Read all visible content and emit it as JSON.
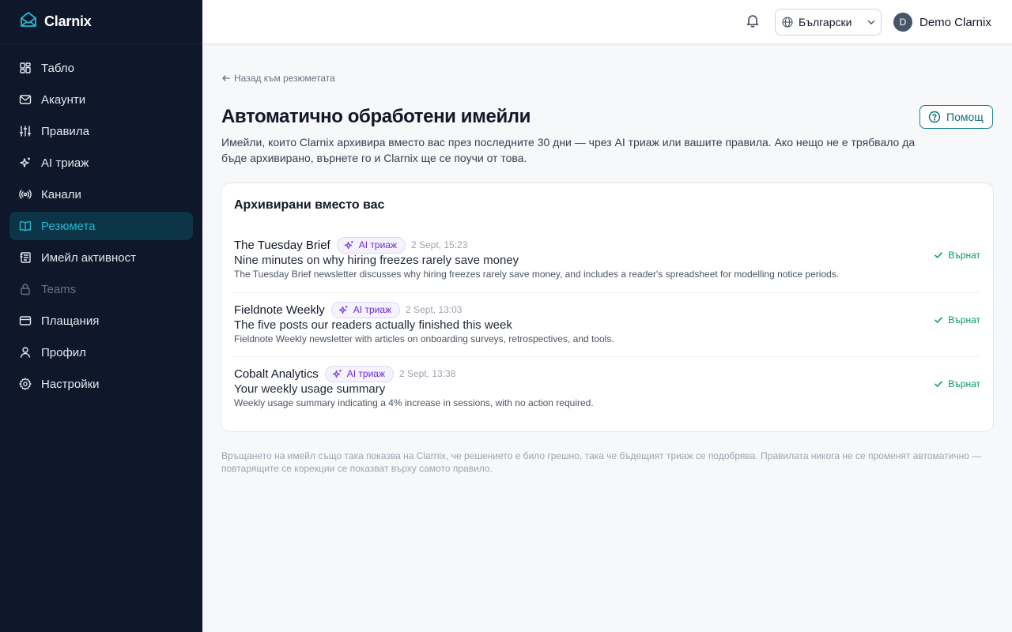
{
  "app": {
    "brand": "Clarnix",
    "accent": "#22b8cf"
  },
  "sidebar": {
    "items": [
      {
        "label": "Табло",
        "icon": "dashboard-icon"
      },
      {
        "label": "Акаунти",
        "icon": "mail-icon"
      },
      {
        "label": "Правила",
        "icon": "sliders-icon"
      },
      {
        "label": "AI триаж",
        "icon": "sparkles-icon"
      },
      {
        "label": "Канали",
        "icon": "radio-icon"
      },
      {
        "label": "Резюмета",
        "icon": "book-open-icon",
        "active": true
      },
      {
        "label": "Имейл активност",
        "icon": "activity-icon"
      },
      {
        "label": "Teams",
        "icon": "lock-icon",
        "disabled": true
      },
      {
        "label": "Плащания",
        "icon": "credit-card-icon"
      },
      {
        "label": "Профил",
        "icon": "user-icon"
      },
      {
        "label": "Настройки",
        "icon": "gear-icon"
      }
    ]
  },
  "topbar": {
    "language": "Български",
    "user_initial": "D",
    "user_name": "Demo Clarnix"
  },
  "page": {
    "back_link": "Назад към резюметата",
    "title": "Автоматично обработени имейли",
    "help_label": "Помощ",
    "description": "Имейли, които Clarnix архивира вместо вас през последните 30 дни — чрез AI триаж или вашите правила. Ако нещо не е трябвало да бъде архивирано, върнете го и Clarnix ще се поучи от това.",
    "card_title": "Архивирани вместо вас",
    "emails": [
      {
        "sender": "The Tuesday Brief",
        "badge": "AI триаж",
        "date": "2 Sept, 15:23",
        "subject": "Nine minutes on why hiring freezes rarely save money",
        "summary": "The Tuesday Brief newsletter discusses why hiring freezes rarely save money, and includes a reader's spreadsheet for modelling notice periods.",
        "status": "Върнат"
      },
      {
        "sender": "Fieldnote Weekly",
        "badge": "AI триаж",
        "date": "2 Sept, 13:03",
        "subject": "The five posts our readers actually finished this week",
        "summary": "Fieldnote Weekly newsletter with articles on onboarding surveys, retrospectives, and tools.",
        "status": "Върнат"
      },
      {
        "sender": "Cobalt Analytics",
        "badge": "AI триаж",
        "date": "2 Sept, 13:38",
        "subject": "Your weekly usage summary",
        "summary": "Weekly usage summary indicating a 4% increase in sessions, with no action required.",
        "status": "Върнат"
      }
    ],
    "footnote": "Връщането на имейл също така показва на Clarnix, че решението е било грешно, така че бъдещият триаж се подобрява. Правилата никога не се променят автоматично — повтарящите се корекции се показват върху самото правило."
  }
}
